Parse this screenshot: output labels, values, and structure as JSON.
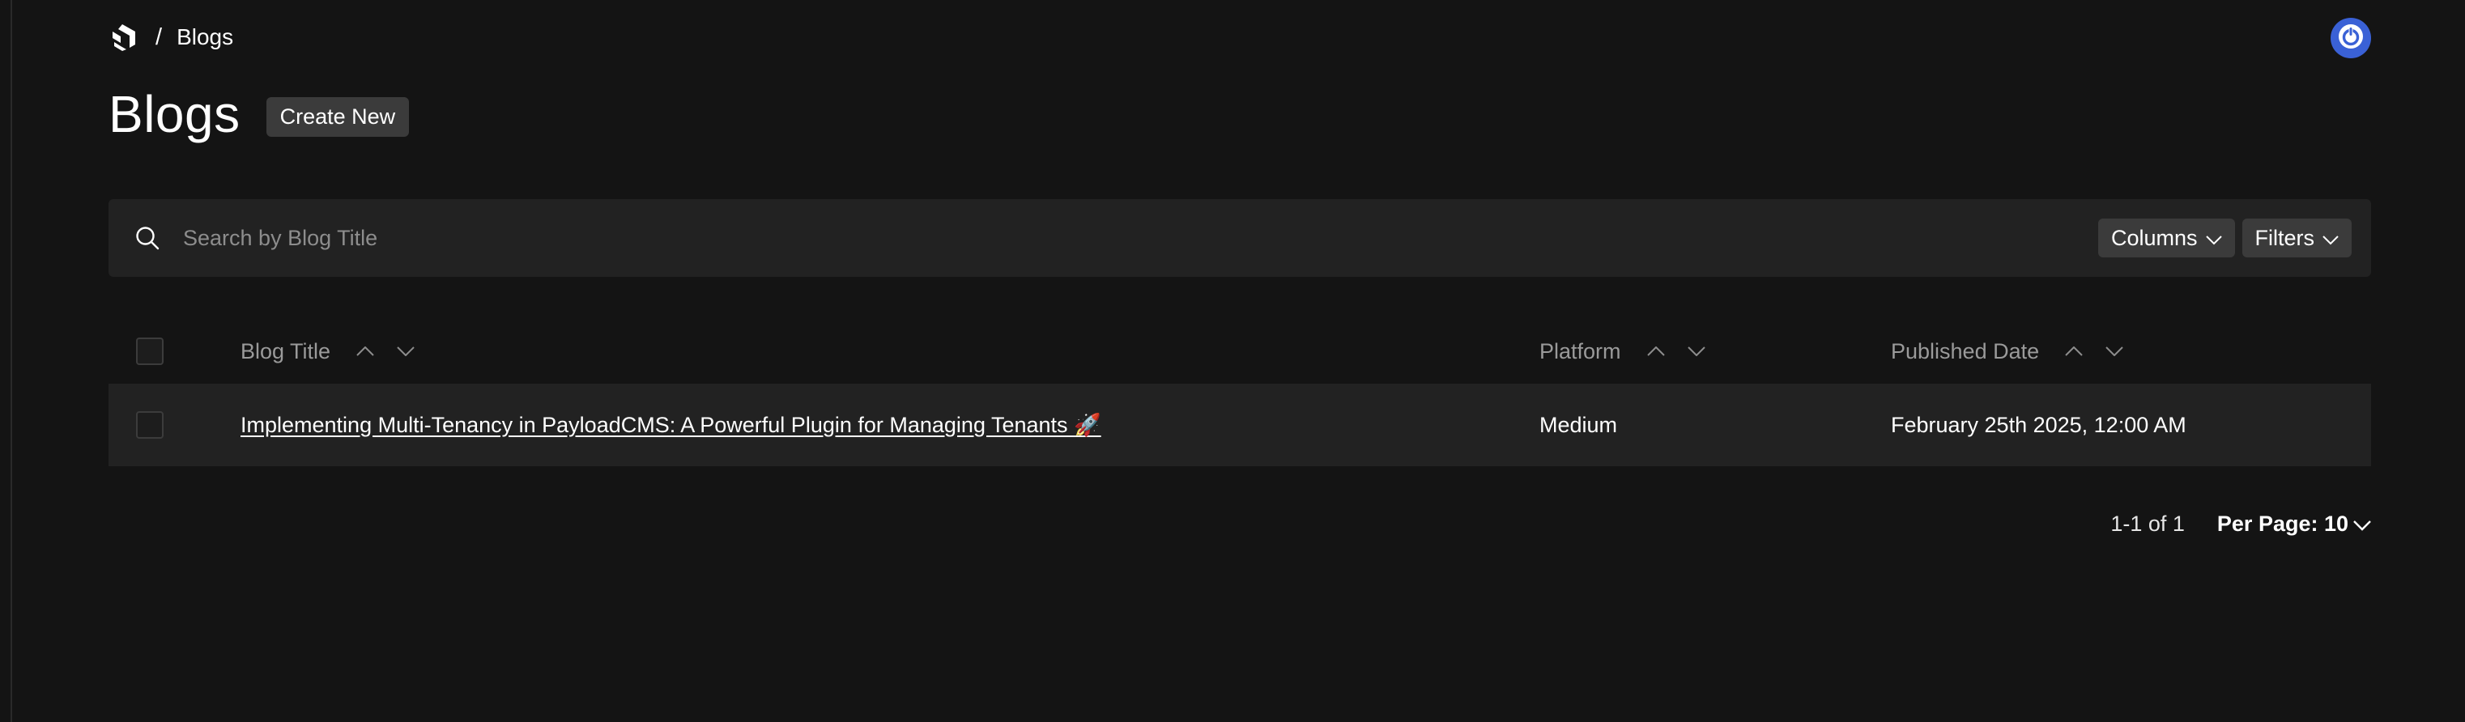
{
  "breadcrumb": {
    "separator": "/",
    "current": "Blogs"
  },
  "header": {
    "title": "Blogs",
    "create_label": "Create New"
  },
  "search": {
    "placeholder": "Search by Blog Title",
    "value": ""
  },
  "toolbar": {
    "columns_label": "Columns",
    "filters_label": "Filters"
  },
  "table": {
    "columns": [
      "Blog Title",
      "Platform",
      "Published Date"
    ],
    "rows": [
      {
        "title": "Implementing Multi-Tenancy in PayloadCMS: A Powerful Plugin for Managing Tenants 🚀",
        "platform": "Medium",
        "published": "February 25th 2025, 12:00 AM"
      }
    ]
  },
  "pagination": {
    "range": "1-1 of 1",
    "per_page_label": "Per Page: 10"
  },
  "colors": {
    "background": "#141414",
    "surface": "#222222",
    "button": "#3b3b3b",
    "account_accent": "#3a61d6"
  },
  "icons": {
    "logo": "payload-logo-icon",
    "account": "power-icon",
    "search": "search-icon",
    "chevron": "chevron-down-icon",
    "sort_up": "chevron-up-icon",
    "sort_down": "chevron-down-icon"
  }
}
